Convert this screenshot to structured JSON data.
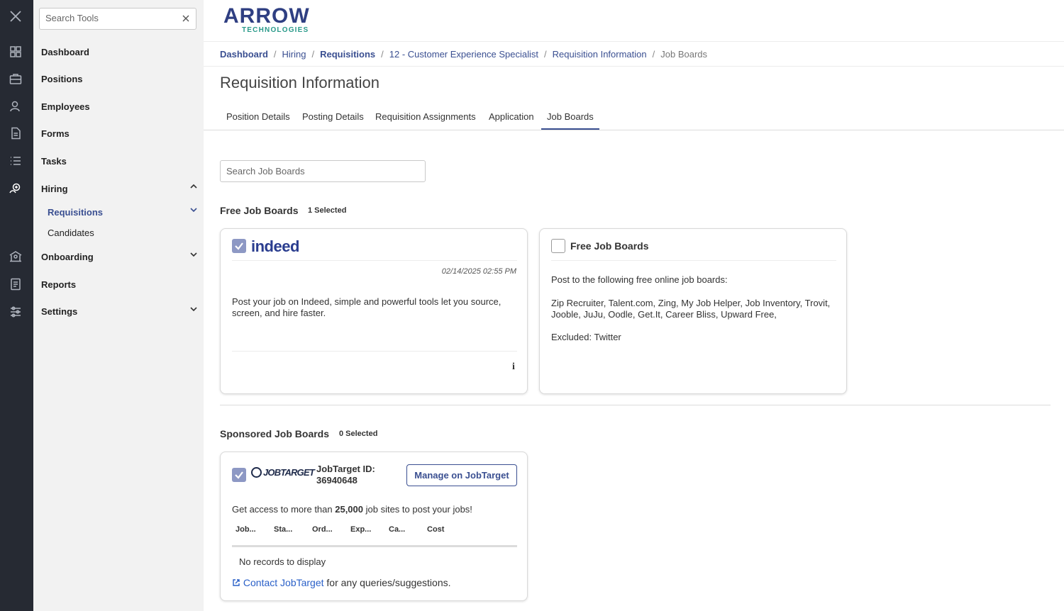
{
  "sidebar": {
    "search_placeholder": "Search Tools",
    "items": [
      {
        "label": "Dashboard"
      },
      {
        "label": "Positions"
      },
      {
        "label": "Employees"
      },
      {
        "label": "Forms"
      },
      {
        "label": "Tasks"
      },
      {
        "label": "Hiring"
      },
      {
        "label": "Onboarding"
      },
      {
        "label": "Reports"
      },
      {
        "label": "Settings"
      }
    ],
    "hiring_sub": [
      {
        "label": "Requisitions"
      },
      {
        "label": "Candidates"
      }
    ]
  },
  "logo": {
    "name": "ARROW",
    "sub": "TECHNOLOGIES"
  },
  "breadcrumb": [
    "Dashboard",
    "Hiring",
    "Requisitions",
    "12 - Customer Experience Specialist",
    "Requisition Information",
    "Job Boards"
  ],
  "page_title": "Requisition Information",
  "tabs": [
    "Position Details",
    "Posting Details",
    "Requisition Assignments",
    "Application",
    "Job Boards"
  ],
  "job_board_search_placeholder": "Search Job Boards",
  "free": {
    "title": "Free Job Boards",
    "count": "1 Selected",
    "indeed": {
      "logo": "indeed",
      "date": "02/14/2025 02:55 PM",
      "description": "Post your job on Indeed, simple and powerful tools let you source, screen, and hire faster.",
      "info": "i"
    },
    "other": {
      "title": "Free Job Boards",
      "intro": "Post to the following free online job boards:",
      "list": "Zip Recruiter, Talent.com, Zing, My Job Helper, Job Inventory, Trovit, Jooble, JuJu, Oodle, Get.It, Career Bliss, Upward Free,",
      "excluded": "Excluded: Twitter"
    }
  },
  "sponsored": {
    "title": "Sponsored Job Boards",
    "count": "0 Selected",
    "jobtarget": {
      "logo": "JOBTARGET",
      "id_label": "JobTarget ID:",
      "id_value": "36940648",
      "manage_label": "Manage on JobTarget",
      "access_pre": "Get access to more than ",
      "access_bold": "25,000",
      "access_post": " job sites to post your jobs!",
      "columns": [
        "Job...",
        "Sta...",
        "Ord...",
        "Exp...",
        "Ca...",
        "Cost"
      ],
      "empty": "No records to display",
      "contact_link": "Contact JobTarget",
      "contact_rest": " for any queries/suggestions."
    }
  },
  "colors": {
    "accent": "#3a4f91",
    "rail": "#262a33",
    "sidebar": "#f2f2f2",
    "link": "#2a60c8"
  }
}
